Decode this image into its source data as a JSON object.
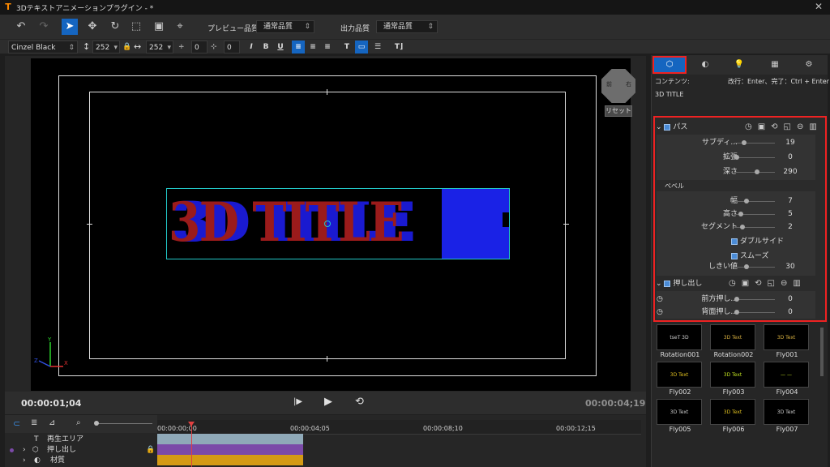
{
  "window": {
    "title": "3Dテキストアニメーションプラグイン - *",
    "close_glyph": "✕",
    "logo": "T"
  },
  "toolbar": {
    "undo": "↶",
    "redo": "↷",
    "select": "➤",
    "move": "✥",
    "rotate": "↻",
    "resize": "⬚",
    "frame": "▣",
    "target": "⌖",
    "preview_quality_label": "プレビュー品質",
    "preview_quality_value": "通常品質",
    "output_quality_label": "出力品質",
    "output_quality_value": "通常品質"
  },
  "format": {
    "font": "Cinzel Black",
    "size": "252",
    "width": "252",
    "kern": "0",
    "lead": "0",
    "italic": "I",
    "bold": "B",
    "underline": "U"
  },
  "viewport": {
    "title_text": "3D TITLE",
    "gizmo_left": "前",
    "gizmo_right": "右",
    "reset_label": "リセット",
    "axis_y": "Y",
    "axis_x": "X",
    "axis_z": "Z"
  },
  "playback": {
    "current_time": "00:00:01;04",
    "end_time": "00:00:04;19",
    "play": "▶",
    "step": "|▶",
    "loop": "⟲"
  },
  "timeline": {
    "ruler": [
      "00:00:00;00",
      "00:00:04;05",
      "00:00:08;10",
      "00:00:12;15"
    ],
    "tracks": [
      {
        "label": "再生エリア",
        "icon": "T"
      },
      {
        "label": "押し出し",
        "icon": "⬡"
      },
      {
        "label": "材質",
        "icon": "◐"
      }
    ],
    "colors": {
      "playarea": "#8fa9b8",
      "extrude": "#7b4aa8",
      "material": "#d49a15",
      "playhead": "#e04040"
    }
  },
  "panel": {
    "tabs": [
      "⬡",
      "◐",
      "💡",
      "▦",
      "⚙"
    ],
    "content_label": "コンテンツ:",
    "content_hint": "改行：Enter、完了：Ctrl + Enter",
    "content_text": "3D TITLE",
    "path_section": "パス",
    "props": [
      {
        "label": "サブディ...",
        "value": "19",
        "level": 0.2
      },
      {
        "label": "拡張",
        "value": "0",
        "level": 0.0
      },
      {
        "label": "深さ",
        "value": "290",
        "level": 0.55
      }
    ],
    "bevel_label": "ベベル",
    "bevel_props": [
      {
        "label": "幅",
        "value": "7",
        "level": 0.25
      },
      {
        "label": "高さ",
        "value": "5",
        "level": 0.1
      },
      {
        "label": "セグメント",
        "value": "2",
        "level": 0.15
      }
    ],
    "double_side": "ダブルサイド",
    "smooth": "スムーズ",
    "threshold": {
      "label": "しきい値",
      "value": "30",
      "level": 0.25
    },
    "extrude_section": "押し出し",
    "extrude_props": [
      {
        "label": "前方押し...",
        "value": "0",
        "level": 0.0
      },
      {
        "label": "背面押し...",
        "value": "0",
        "level": 0.0
      }
    ]
  },
  "presets": [
    {
      "name": "Rotation001",
      "thumb": "tseT 3D",
      "color": "#cfcfcf"
    },
    {
      "name": "Rotation002",
      "thumb": "3D Text",
      "color": "#d8b040"
    },
    {
      "name": "Fly001",
      "thumb": "3D Text",
      "color": "#d8b040"
    },
    {
      "name": "Fly002",
      "thumb": "3D Text",
      "color": "#e0c020"
    },
    {
      "name": "Fly003",
      "thumb": "3D Text",
      "color": "#c0e020"
    },
    {
      "name": "Fly004",
      "thumb": "— —",
      "color": "#c0e020"
    },
    {
      "name": "Fly005",
      "thumb": "3D Text",
      "color": "#cfcfcf"
    },
    {
      "name": "Fly006",
      "thumb": "3D Text",
      "color": "#e0c020"
    },
    {
      "name": "Fly007",
      "thumb": "3D Text",
      "color": "#cfcfcf"
    }
  ]
}
